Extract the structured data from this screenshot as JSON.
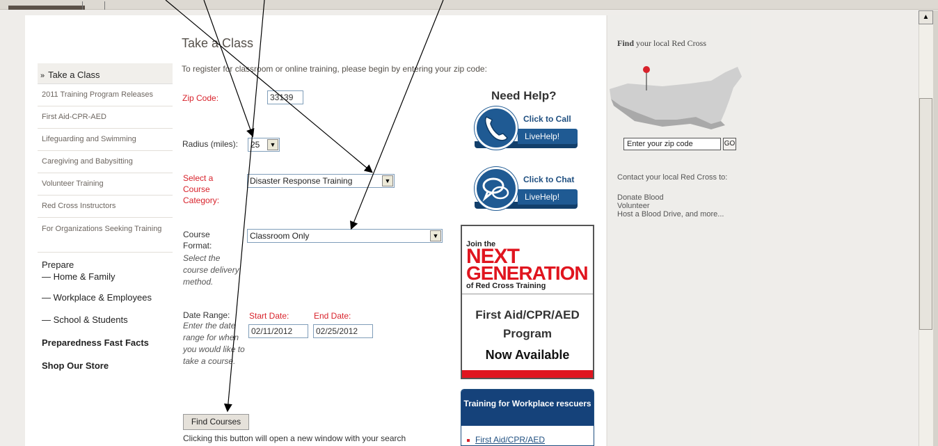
{
  "title": "Take a Class",
  "intro": "To register for classroom or online training, please begin by entering your zip code:",
  "nav": {
    "active": "Take a Class",
    "items": [
      "2011 Training Program Releases",
      "First Aid-CPR-AED",
      "Lifeguarding and Swimming",
      "Caregiving and Babysitting",
      "Volunteer Training",
      "Red Cross Instructors",
      "For Organizations Seeking Training"
    ],
    "prepare_label": "Prepare",
    "prepare_items": [
      "— Home & Family",
      "— Workplace & Employees",
      "— School & Students"
    ],
    "fast_facts": "Preparedness Fast Facts",
    "shop": "Shop Our Store"
  },
  "form": {
    "zip_label": "Zip Code:",
    "zip_value": "33139",
    "radius_label": "Radius (miles):",
    "radius_value": "25",
    "category_label": "Select a Course Category:",
    "category_value": "Disaster Response Training",
    "format_label": "Course Format:",
    "format_hint": "Select the course delivery method.",
    "format_value": "Classroom Only",
    "date_label": "Date Range:",
    "date_hint": "Enter the date range for when you would like to take a course.",
    "start_label": "Start Date:",
    "start_value": "02/11/2012",
    "end_label": "End Date:",
    "end_value": "02/25/2012",
    "find_button": "Find Courses",
    "find_note": "Clicking this button will open a new window with your search"
  },
  "help": {
    "title": "Need Help?",
    "call_text": "Click to Call",
    "chat_text": "Click to Chat",
    "live_text": "LiveHelp!"
  },
  "ad": {
    "join": "Join the",
    "next": "NEXT",
    "generation": "GENERATION",
    "of": "of Red Cross Training",
    "program_line1": "First Aid/CPR/AED",
    "program_line2": "Program",
    "available": "Now Available"
  },
  "training": {
    "title": "Training for Workplace rescuers",
    "link": "First Aid/CPR/AED"
  },
  "sidebar": {
    "find_bold": "Find",
    "find_rest": " your local Red Cross",
    "zip_placeholder": "Enter your zip code",
    "go": "GO",
    "contact": "Contact your local Red Cross to:",
    "links": [
      "Donate Blood",
      "Volunteer",
      "Host a Blood Drive, and more..."
    ]
  },
  "colors": {
    "red": "#d8222b",
    "navy": "#1f5a93",
    "dark_navy": "#15427a"
  }
}
